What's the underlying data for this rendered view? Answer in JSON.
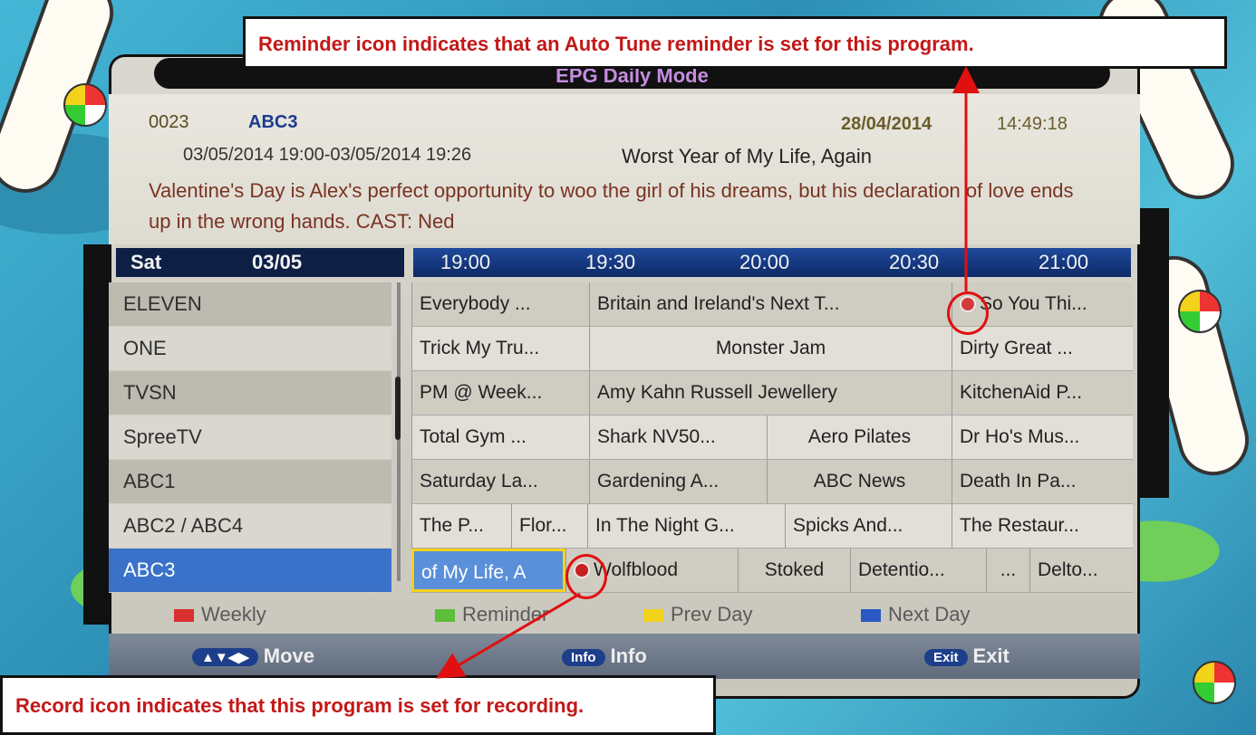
{
  "header": {
    "title": "EPG Daily Mode",
    "channel_number": "0023",
    "channel_name": "ABC3",
    "current_date": "28/04/2014",
    "current_time": "14:49:18"
  },
  "program_info": {
    "time_range": "03/05/2014 19:00-03/05/2014 19:26",
    "title": "Worst Year of My Life, Again",
    "description": "Valentine's Day is Alex's perfect opportunity to woo the girl of his dreams, but his declaration of love ends up in the wrong hands. CAST: Ned"
  },
  "grid_header": {
    "day": "Sat",
    "date": "03/05",
    "times": [
      "19:00",
      "19:30",
      "20:00",
      "20:30",
      "21:00"
    ]
  },
  "channels": [
    "ELEVEN",
    "ONE",
    "TVSN",
    "SpreeTV",
    "ABC1",
    "ABC2 / ABC4",
    "ABC3"
  ],
  "programs": {
    "eleven": [
      "Everybody ...",
      "Britain and Ireland's Next T...",
      "So You Thi..."
    ],
    "one": [
      "Trick My Tru...",
      "Monster Jam",
      "Dirty Great ..."
    ],
    "tvsn": [
      "PM @ Week...",
      "Amy Kahn Russell Jewellery",
      "KitchenAid P..."
    ],
    "spreetv": [
      "Total Gym ...",
      "Shark NV50...",
      "Aero Pilates",
      "Dr Ho's Mus..."
    ],
    "abc1": [
      "Saturday La...",
      "Gardening A...",
      "ABC News",
      "Death In Pa..."
    ],
    "abc2": [
      "The P...",
      "Flor...",
      "In The Night G...",
      "Spicks And...",
      "The Restaur..."
    ],
    "abc3": [
      "of My Life, A",
      "Wolfblood",
      "Stoked",
      "Detentio...",
      "...",
      "Delto..."
    ]
  },
  "legend": {
    "weekly": "Weekly",
    "reminder": "Reminder",
    "prev_day": "Prev Day",
    "next_day": "Next Day",
    "colors": {
      "weekly": "#d93030",
      "reminder": "#5cbf3a",
      "prev_day": "#f3d21b",
      "next_day": "#2a59c4"
    }
  },
  "nav": {
    "move_key": "▲▼◀▶",
    "move_label": "Move",
    "info_key": "Info",
    "info_label": "Info",
    "exit_key": "Exit",
    "exit_label": "Exit"
  },
  "annotations": {
    "reminder_note": "Reminder icon indicates that an Auto Tune reminder is set for this program.",
    "record_note": "Record icon indicates that this program is set for recording."
  }
}
